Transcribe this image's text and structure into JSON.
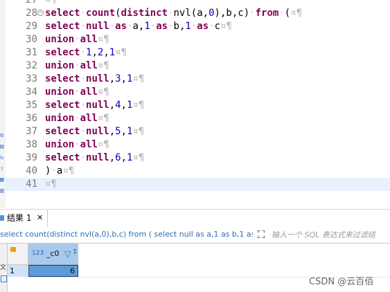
{
  "editor": {
    "whitespace_marker": "¤",
    "pilcrow": "¶",
    "lines": [
      {
        "num": "27",
        "code": ""
      },
      {
        "num": "28",
        "code": "select count(distinct nvl(a,0),b,c) from ("
      },
      {
        "num": "29",
        "code": "select null as a,1 as b,1 as c"
      },
      {
        "num": "30",
        "code": "union all"
      },
      {
        "num": "31",
        "code": "select 1,2,1"
      },
      {
        "num": "32",
        "code": "union all"
      },
      {
        "num": "33",
        "code": "select null,3,1"
      },
      {
        "num": "34",
        "code": "union all"
      },
      {
        "num": "35",
        "code": "select null,4,1"
      },
      {
        "num": "36",
        "code": "union all"
      },
      {
        "num": "37",
        "code": "select null,5,1"
      },
      {
        "num": "38",
        "code": "union all"
      },
      {
        "num": "39",
        "code": "select null,6,1"
      },
      {
        "num": "40",
        "code": ") a"
      },
      {
        "num": "41",
        "code": ""
      }
    ],
    "current_line": "41",
    "folded_line": "28"
  },
  "results": {
    "tab_label": "结果 1",
    "tab_close": "✕",
    "query_text": "select count(distinct nvl(a,0),b,c) from ( select null as a,1 as b,1 as c",
    "filter_placeholder": "输入一个 SQL 表达式来过滤结",
    "left_vertical_tab": "文",
    "grid": {
      "columns": [
        {
          "type_badge": "123",
          "name": "_c0"
        }
      ],
      "rows": [
        {
          "row_num": "1",
          "values": [
            "6"
          ]
        }
      ]
    }
  },
  "watermark": "CSDN @云百佰",
  "icons": [
    "strip-icon",
    "fold-icon",
    "result-tab-icon",
    "close-icon",
    "expand-icon",
    "lock-icon",
    "column-filter-icon",
    "column-sort-icon",
    "grid-view-icon"
  ]
}
